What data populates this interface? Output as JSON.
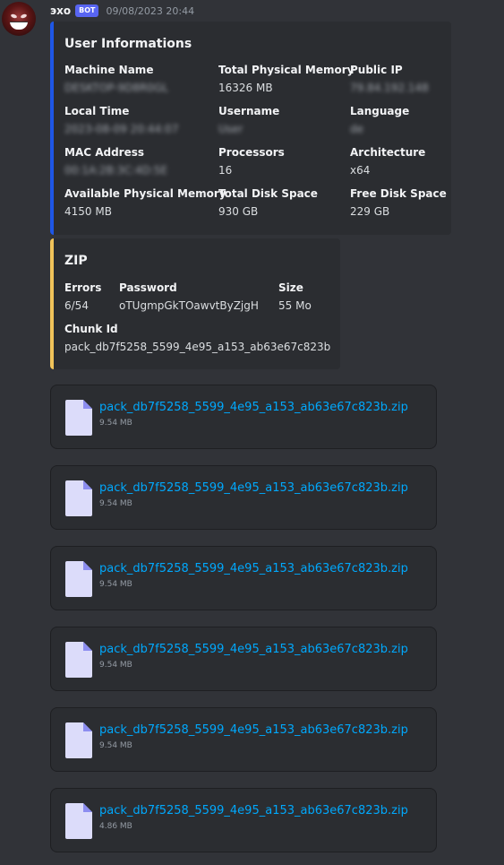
{
  "message": {
    "author": "эхо",
    "bot_tag": "BOT",
    "timestamp": "09/08/2023 20:44"
  },
  "colors": {
    "accent_blue": "#1e57e6",
    "accent_yellow": "#f0c35a",
    "link": "#00a8fc",
    "bot_badge": "#5865f2"
  },
  "embed_user": {
    "title": "User Informations",
    "fields": [
      {
        "name": "Machine Name",
        "value": "DESKTOP-9D8R0GL",
        "blurred": true
      },
      {
        "name": "Total Physical Memory",
        "value": "16326 MB",
        "blurred": false
      },
      {
        "name": "Public IP",
        "value": "79.84.192.148",
        "blurred": true
      },
      {
        "name": "Local Time",
        "value": "2023-08-09 20:44:07",
        "blurred": true
      },
      {
        "name": "Username",
        "value": "User",
        "blurred": true
      },
      {
        "name": "Language",
        "value": "de",
        "blurred": true
      },
      {
        "name": "MAC Address",
        "value": "00:1A:2B:3C:4D:5E",
        "blurred": true
      },
      {
        "name": "Processors",
        "value": "16",
        "blurred": false
      },
      {
        "name": "Architecture",
        "value": "x64",
        "blurred": false
      },
      {
        "name": "Available Physical Memory",
        "value": "4150 MB",
        "blurred": false
      },
      {
        "name": "Total Disk Space",
        "value": "930 GB",
        "blurred": false
      },
      {
        "name": "Free Disk Space",
        "value": "229 GB",
        "blurred": false
      }
    ]
  },
  "embed_zip": {
    "title": "ZIP",
    "fields": [
      {
        "name": "Errors",
        "value": "6/54"
      },
      {
        "name": "Password",
        "value": "oTUgmpGkTOawvtByZjgH"
      },
      {
        "name": "Size",
        "value": "55 Mo"
      },
      {
        "name": "Chunk Id",
        "value": "pack_db7f5258_5599_4e95_a153_ab63e67c823b"
      }
    ]
  },
  "attachments": [
    {
      "name": "pack_db7f5258_5599_4e95_a153_ab63e67c823b.zip",
      "size": "9.54 MB",
      "icon": "file-icon"
    },
    {
      "name": "pack_db7f5258_5599_4e95_a153_ab63e67c823b.zip",
      "size": "9.54 MB",
      "icon": "file-icon"
    },
    {
      "name": "pack_db7f5258_5599_4e95_a153_ab63e67c823b.zip",
      "size": "9.54 MB",
      "icon": "file-icon"
    },
    {
      "name": "pack_db7f5258_5599_4e95_a153_ab63e67c823b.zip",
      "size": "9.54 MB",
      "icon": "file-icon"
    },
    {
      "name": "pack_db7f5258_5599_4e95_a153_ab63e67c823b.zip",
      "size": "9.54 MB",
      "icon": "file-icon"
    },
    {
      "name": "pack_db7f5258_5599_4e95_a153_ab63e67c823b.zip",
      "size": "4.86 MB",
      "icon": "file-icon"
    }
  ]
}
